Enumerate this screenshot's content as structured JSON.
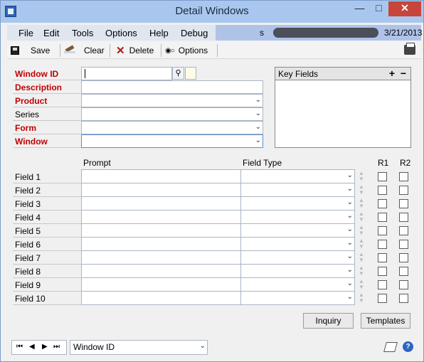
{
  "window": {
    "title": "Detail Windows"
  },
  "menu": {
    "items": [
      "File",
      "Edit",
      "Tools",
      "Options",
      "Help",
      "Debug"
    ],
    "user_prefix": "s",
    "date": "3/21/2013"
  },
  "toolbar": {
    "save_label": "Save",
    "clear_label": "Clear",
    "delete_label": "Delete",
    "options_label": "Options"
  },
  "form": {
    "window_id_label": "Window ID",
    "window_id_value": "",
    "description_label": "Description",
    "product_label": "Product",
    "series_label": "Series",
    "form_label": "Form",
    "window_label": "Window"
  },
  "key_fields": {
    "title": "Key Fields",
    "add": "+",
    "remove": "−"
  },
  "grid": {
    "prompt_header": "Prompt",
    "type_header": "Field Type",
    "r1_header": "R1",
    "r2_header": "R2",
    "rows": [
      "Field 1",
      "Field 2",
      "Field 3",
      "Field 4",
      "Field 5",
      "Field 6",
      "Field 7",
      "Field 8",
      "Field 9",
      "Field 10"
    ]
  },
  "buttons": {
    "inquiry": "Inquiry",
    "templates": "Templates"
  },
  "browse": {
    "sort_by": "Window ID"
  }
}
